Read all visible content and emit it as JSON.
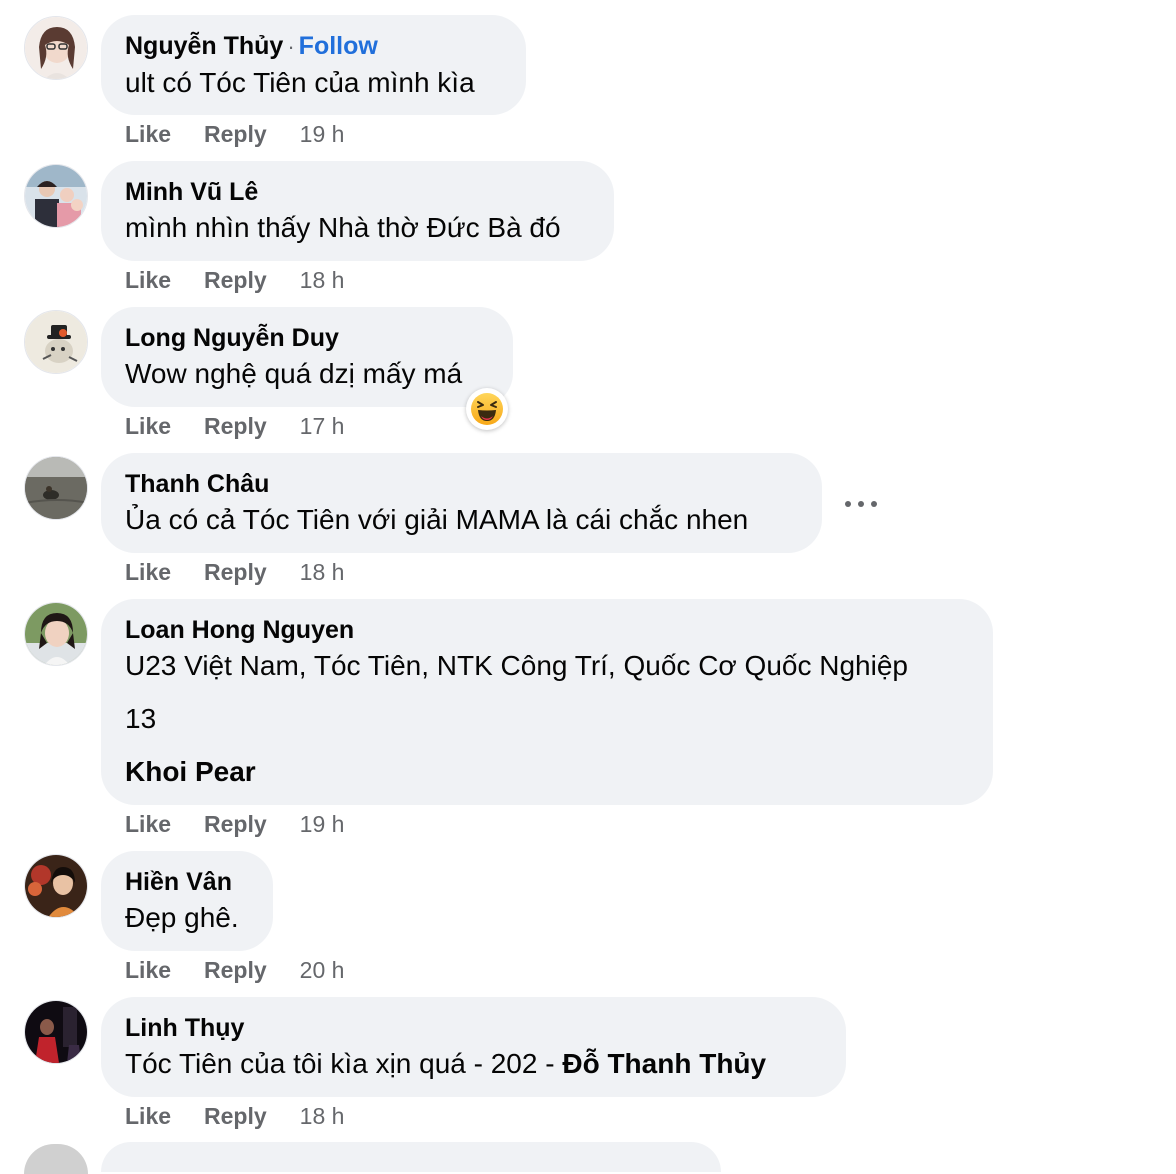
{
  "comments": [
    {
      "author": "Nguyễn Thủy",
      "follow": "Follow",
      "text": "ult có Tóc Tiên của mình kìa",
      "like": "Like",
      "reply": "Reply",
      "time": "19 h"
    },
    {
      "author": "Minh Vũ Lê",
      "text": "mình nhìn thấy Nhà thờ Đức Bà đó",
      "like": "Like",
      "reply": "Reply",
      "time": "18 h"
    },
    {
      "author": "Long Nguyễn Duy",
      "text": "Wow nghệ quá dzị mấy má",
      "like": "Like",
      "reply": "Reply",
      "time": "17 h",
      "reaction": "haha-emoji"
    },
    {
      "author": "Thanh Châu",
      "text": "Ủa có cả Tóc Tiên với giải MAMA là cái chắc nhen",
      "like": "Like",
      "reply": "Reply",
      "time": "18 h",
      "more_icon": "more-horizontal-icon"
    },
    {
      "author": "Loan Hong Nguyen",
      "lines": [
        "U23 Việt Nam, Tóc Tiên, NTK Công Trí, Quốc Cơ Quốc Nghiệp",
        "13",
        "Khoi Pear"
      ],
      "like": "Like",
      "reply": "Reply",
      "time": "19 h"
    },
    {
      "author": "Hiền Vân",
      "text": "Đẹp ghê.",
      "like": "Like",
      "reply": "Reply",
      "time": "20 h"
    },
    {
      "author": "Linh Thụy",
      "text_prefix": "Tóc Tiên của tôi kìa xịn quá - 202 - ",
      "mention": "Đỗ Thanh Thủy",
      "like": "Like",
      "reply": "Reply",
      "time": "18 h"
    }
  ],
  "colors": {
    "bubble": "#f0f2f5",
    "secondary_text": "#65676b",
    "link": "#216fdb"
  }
}
